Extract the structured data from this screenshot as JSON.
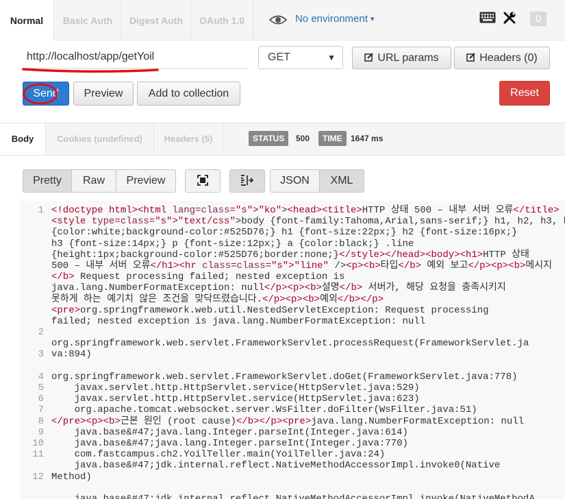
{
  "auth_tabs": [
    "Normal",
    "Basic Auth",
    "Digest Auth",
    "OAuth 1.0"
  ],
  "environment": {
    "label": "No environment",
    "caret": "▾"
  },
  "header_icons": {
    "keyboard": "keyboard-icon",
    "tools": "wrench-screwdriver-icon",
    "notification_count": "0"
  },
  "request": {
    "url": "http://localhost/app/getYoil",
    "method": "GET",
    "url_params_label": "URL params",
    "headers_label": "Headers (0)"
  },
  "actions": {
    "send": "Send",
    "preview": "Preview",
    "add_to_collection": "Add to collection",
    "reset": "Reset"
  },
  "response": {
    "tabs": [
      "Body",
      "Cookies (undefined)",
      "Headers (5)"
    ],
    "status_label": "STATUS",
    "status_value": "500",
    "time_label": "TIME",
    "time_value": "1647 ms"
  },
  "view_modes": [
    "Pretty",
    "Raw",
    "Preview"
  ],
  "format_modes": [
    "JSON",
    "XML"
  ],
  "colors": {
    "send": "#2d7cd1",
    "reset": "#d9443f",
    "annotation": "#e0101a",
    "link": "#2a6fb0"
  },
  "code": {
    "line_numbers": [
      "1",
      "",
      "",
      "",
      "",
      "",
      "",
      "",
      "",
      "",
      "",
      "2",
      "",
      "3",
      "",
      "4",
      "5",
      "6",
      "7",
      "8",
      "9",
      "10",
      "11",
      "",
      "12",
      ""
    ],
    "lines": [
      "<!doctype html><html lang=\"ko\"><head><title>HTTP 상태 500 – 내부 서버 오류</title>",
      "<style type=\"text/css\">body {font-family:Tahoma,Arial,sans-serif;} h1, h2, h3, b",
      "{color:white;background-color:#525D76;} h1 {font-size:22px;} h2 {font-size:16px;}",
      "h3 {font-size:14px;} p {font-size:12px;} a {color:black;} .line",
      "{height:1px;background-color:#525D76;border:none;}</style></head><body><h1>HTTP 상태",
      "500 – 내부 서버 오류</h1><hr class=\"line\" /><p><b>타입</b> 예외 보고</p><p><b>메시지",
      "</b> Request processing failed; nested exception is",
      "java.lang.NumberFormatException: null</p><p><b>설명</b> 서버가, 해당 요청을 충족시키지",
      "못하게 하는 예기치 않은 조건을 맞닥뜨렸습니다.</p><p><b>예외</b></p>",
      "<pre>org.springframework.web.util.NestedServletException: Request processing",
      "failed; nested exception is java.lang.NumberFormatException: null",
      "",
      "org.springframework.web.servlet.FrameworkServlet.processRequest(FrameworkServlet.ja",
      "va:894)",
      "",
      "org.springframework.web.servlet.FrameworkServlet.doGet(FrameworkServlet.java:778)",
      "    javax.servlet.http.HttpServlet.service(HttpServlet.java:529)",
      "    javax.servlet.http.HttpServlet.service(HttpServlet.java:623)",
      "    org.apache.tomcat.websocket.server.WsFilter.doFilter(WsFilter.java:51)",
      "</pre><p><b>근본 원인 (root cause)</b></p><pre>java.lang.NumberFormatException: null",
      "    java.base&#47;java.lang.Integer.parseInt(Integer.java:614)",
      "    java.base&#47;java.lang.Integer.parseInt(Integer.java:770)",
      "    com.fastcampus.ch2.YoilTeller.main(YoilTeller.java:24)",
      "    java.base&#47;jdk.internal.reflect.NativeMethodAccessorImpl.invoke0(Native",
      "Method)",
      "",
      "    java.base&#47;jdk.internal.reflect.NativeMethodAccessorImpl.invoke(NativeMethodA"
    ]
  }
}
